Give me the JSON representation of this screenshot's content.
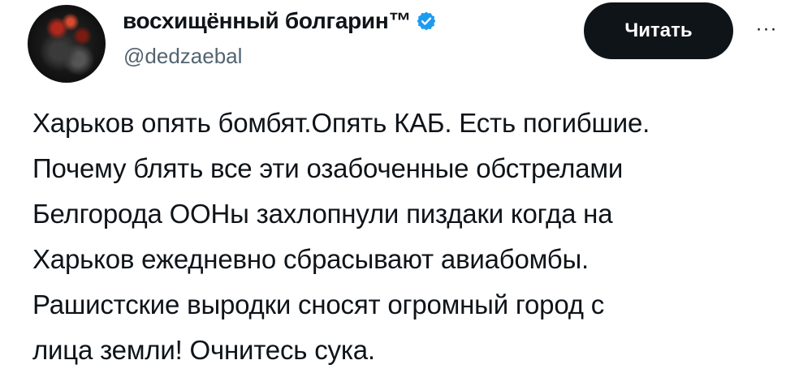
{
  "tweet": {
    "author": {
      "display_name": "восхищённый болгарин™",
      "handle": "@dedzaebal",
      "verified": true
    },
    "follow_button_label": "Читать",
    "more_label": "···",
    "text_lines": [
      "Харьков опять бомбят.Опять КАБ. Есть погибшие.",
      "Почему блять все эти озабоченные обстрелами",
      "Белгорода ООНы захлопнули пиздаки когда на",
      "Харьков ежедневно сбрасывают авиабомбы.",
      "Рашистские выродки сносят огромный город с",
      "лица земли! Очнитесь сука."
    ]
  },
  "icons": {
    "verified": "verified-badge-icon",
    "more": "more-horizontal-icon"
  },
  "colors": {
    "text": "#0f1419",
    "secondary_text": "#536471",
    "verified_blue": "#1d9bf0",
    "button_bg": "#0f1419",
    "button_text": "#ffffff"
  }
}
